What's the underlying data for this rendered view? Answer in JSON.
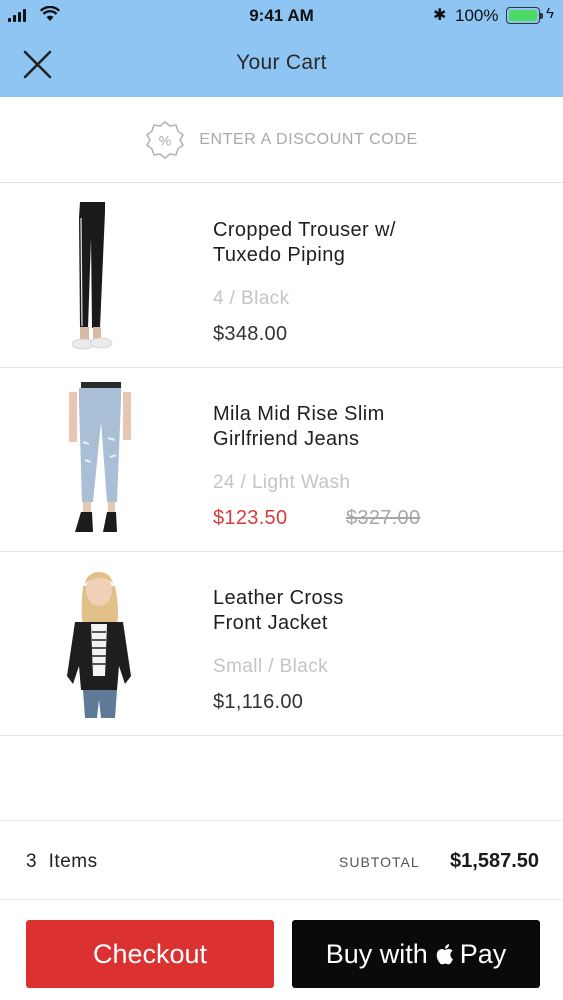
{
  "status_bar": {
    "time": "9:41 AM",
    "battery_percent": "100%",
    "battery_color": "#4cd964"
  },
  "header": {
    "title": "Your Cart",
    "close_icon": "close-icon",
    "background": "#8ec5f2"
  },
  "discount": {
    "label": "ENTER A DISCOUNT CODE",
    "icon": "percent-badge-icon"
  },
  "items": [
    {
      "name_line1": "Cropped Trouser w/",
      "name_line2": "Tuxedo Piping",
      "variant": "4 / Black",
      "price": "$348.00",
      "image": "product-image-trouser"
    },
    {
      "name_line1": "Mila Mid Rise Slim",
      "name_line2": "Girlfriend Jeans",
      "variant": "24 / Light Wash",
      "price": "$123.50",
      "original_price": "$327.00",
      "image": "product-image-jeans"
    },
    {
      "name_line1": "Leather Cross",
      "name_line2": "Front Jacket",
      "variant": "Small / Black",
      "price": "$1,116.00",
      "image": "product-image-jacket"
    }
  ],
  "summary": {
    "count": "3",
    "items_label": "Items",
    "subtotal_label": "SUBTOTAL",
    "subtotal": "$1,587.50"
  },
  "actions": {
    "checkout_label": "Checkout",
    "applepay_prefix": "Buy with",
    "applepay_suffix": "Pay",
    "checkout_color": "#db3131"
  }
}
